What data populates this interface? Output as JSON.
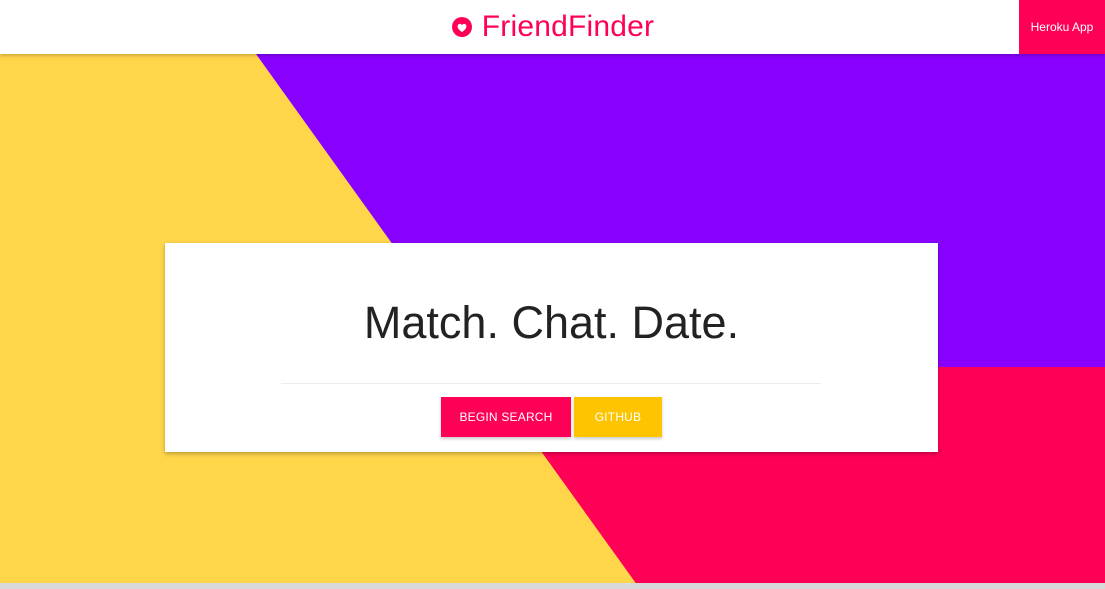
{
  "colors": {
    "brand": "#ff0057",
    "background_yellow": "#ffd54a",
    "background_purple": "#8800ff",
    "background_pink": "#ff0057",
    "button_yellow": "#ffc400"
  },
  "header": {
    "brand_icon": "heart-icon",
    "brand_text": "FriendFinder",
    "nav_button": "Heroku App"
  },
  "hero": {
    "headline": "Match. Chat. Date.",
    "primary_button": "BEGIN SEARCH",
    "secondary_button": "GITHUB"
  }
}
